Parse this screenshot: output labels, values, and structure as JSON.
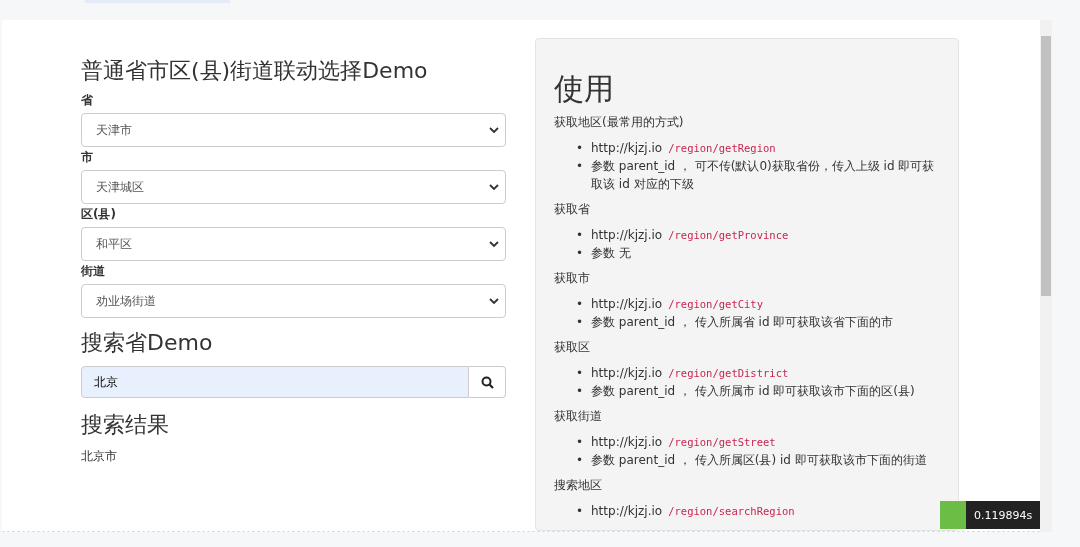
{
  "cascade": {
    "title": "普通省市区(县)街道联动选择Demo",
    "selects": [
      {
        "label": "省",
        "value": "天津市"
      },
      {
        "label": "市",
        "value": "天津城区"
      },
      {
        "label": "区(县)",
        "value": "和平区"
      },
      {
        "label": "街道",
        "value": "劝业场街道"
      }
    ]
  },
  "search": {
    "title": "搜索省Demo",
    "value": "北京"
  },
  "results": {
    "title": "搜索结果",
    "items": [
      "北京市"
    ]
  },
  "usage": {
    "title": "使用",
    "bullet": "•",
    "sections": [
      {
        "heading": "获取地区(最常用的方式)",
        "host": "http://kjzj.io",
        "path": "/region/getRegion",
        "params": "参数 parent_id ， 可不传(默认0)获取省份，传入上级 id 即可获取该 id 对应的下级"
      },
      {
        "heading": "获取省",
        "host": "http://kjzj.io",
        "path": "/region/getProvince",
        "params": "参数 无"
      },
      {
        "heading": "获取市",
        "host": "http://kjzj.io",
        "path": "/region/getCity",
        "params": "参数 parent_id ， 传入所属省 id 即可获取该省下面的市"
      },
      {
        "heading": "获取区",
        "host": "http://kjzj.io",
        "path": "/region/getDistrict",
        "params": "参数 parent_id ， 传入所属市 id 即可获取该市下面的区(县)"
      },
      {
        "heading": "获取街道",
        "host": "http://kjzj.io",
        "path": "/region/getStreet",
        "params": "参数 parent_id ， 传入所属区(县) id 即可获取该市下面的街道"
      },
      {
        "heading": "搜索地区",
        "host": "http://kjzj.io",
        "path": "/region/searchRegion"
      }
    ]
  },
  "debug": {
    "time": "0.119894s"
  }
}
